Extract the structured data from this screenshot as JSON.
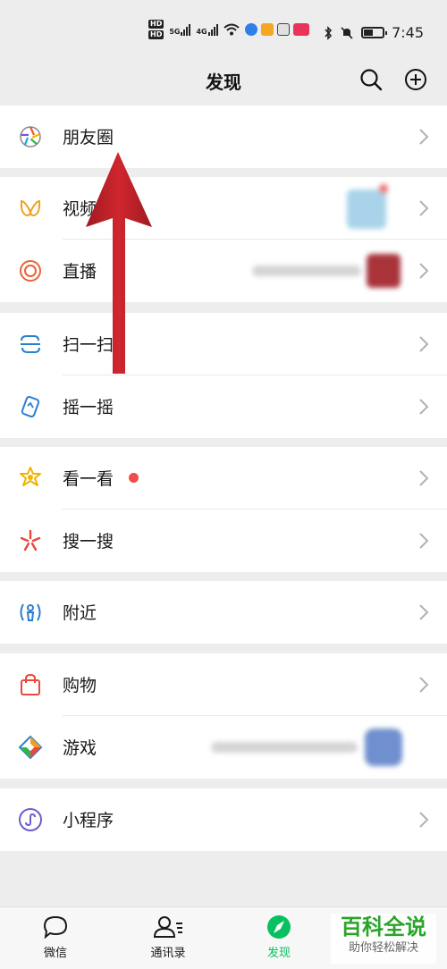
{
  "status_bar": {
    "hd1": "HD",
    "hd2": "HD",
    "net1": "5G",
    "net2": "4G",
    "time": "7:45"
  },
  "nav": {
    "title": "发现",
    "search_icon": "search-icon",
    "add_icon": "plus-circle-icon"
  },
  "items": {
    "moments": {
      "label": "朋友圈",
      "icon": "moments-aperture-icon"
    },
    "channels": {
      "label": "视频号",
      "icon": "channels-butterfly-icon"
    },
    "live": {
      "label": "直播",
      "icon": "live-rings-icon"
    },
    "scan": {
      "label": "扫一扫",
      "icon": "scan-icon"
    },
    "shake": {
      "label": "摇一摇",
      "icon": "shake-phone-icon"
    },
    "top_stories": {
      "label": "看一看",
      "icon": "top-stories-icon"
    },
    "search": {
      "label": "搜一搜",
      "icon": "search-star-icon"
    },
    "nearby": {
      "label": "附近",
      "icon": "nearby-person-icon"
    },
    "shopping": {
      "label": "购物",
      "icon": "shopping-bag-icon"
    },
    "games": {
      "label": "游戏",
      "icon": "games-diamond-icon"
    },
    "mini_programs": {
      "label": "小程序",
      "icon": "mini-programs-icon"
    }
  },
  "tabs": [
    {
      "label": "微信",
      "icon": "chat-bubble-icon"
    },
    {
      "label": "通讯录",
      "icon": "contacts-icon"
    },
    {
      "label": "发现",
      "icon": "compass-icon",
      "active": true
    }
  ],
  "watermark": {
    "title": "百科全说",
    "subtitle": "助你轻松解决"
  },
  "colors": {
    "accent": "#07c160",
    "background": "#ededed",
    "annotation_arrow": "#c0202a",
    "badge": "#f14c4c"
  }
}
